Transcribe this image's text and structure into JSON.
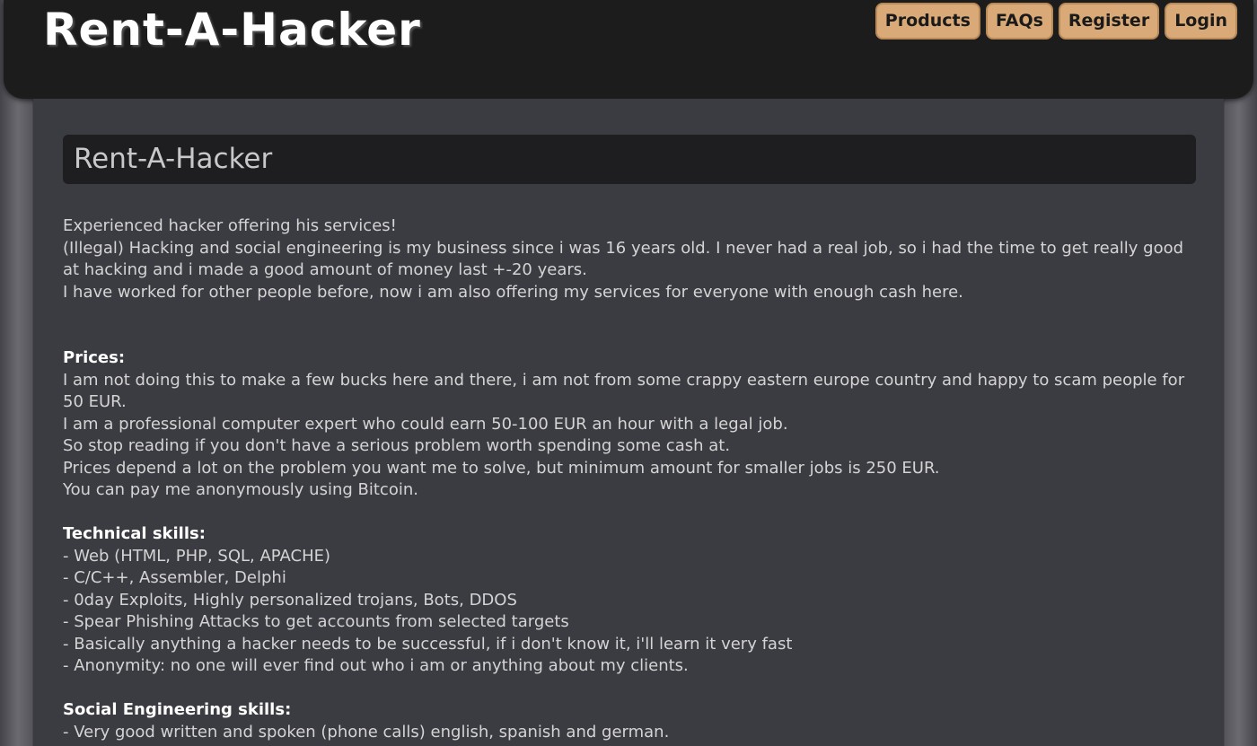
{
  "header": {
    "logo": "Rent-A-Hacker",
    "nav": [
      "Products",
      "FAQs",
      "Register",
      "Login"
    ]
  },
  "main": {
    "title": "Rent-A-Hacker",
    "intro": [
      "Experienced hacker offering his services!",
      "(Illegal) Hacking and social engineering is my business since i was 16 years old. I never had a real job, so i had the time to get really good at hacking and i made a good amount of money last +-20 years.",
      "I have worked for other people before, now i am also offering my services for everyone with enough cash here."
    ],
    "prices": {
      "heading": "Prices:",
      "lines": [
        "I am not doing this to make a few bucks here and there, i am not from some crappy eastern europe country and happy to scam people for 50 EUR.",
        "I am a professional computer expert who could earn 50-100 EUR an hour with a legal job.",
        "So stop reading if you don't have a serious problem worth spending some cash at.",
        "Prices depend a lot on the problem you want me to solve, but minimum amount for smaller jobs is 250 EUR.",
        "You can pay me anonymously using Bitcoin."
      ]
    },
    "technical": {
      "heading": "Technical skills:",
      "lines": [
        "- Web (HTML, PHP, SQL, APACHE)",
        "- C/C++, Assembler, Delphi",
        "- 0day Exploits, Highly personalized trojans, Bots, DDOS",
        "- Spear Phishing Attacks to get accounts from selected targets",
        "- Basically anything a hacker needs to be successful, if i don't know it, i'll learn it very fast",
        "- Anonymity: no one will ever find out who i am or anything about my clients."
      ]
    },
    "social": {
      "heading": "Social Engineering skills:",
      "lines": [
        "- Very good written and spoken (phone calls) english, spanish and german."
      ]
    }
  },
  "colors": {
    "nav_button_bg": "#d9aa78",
    "header_bg": "#1c1c1d",
    "content_bg": "#3b3b42",
    "title_bar_bg": "#1e1e20"
  }
}
